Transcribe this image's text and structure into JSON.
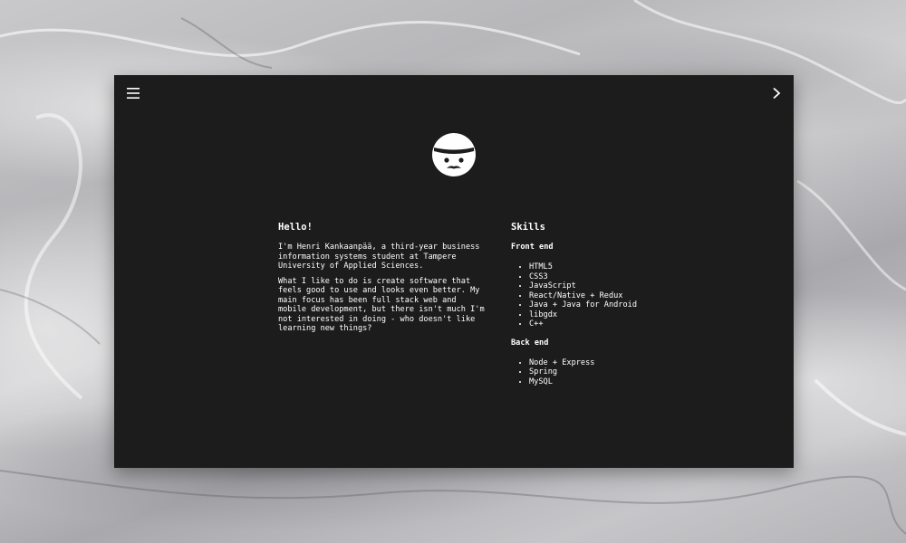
{
  "about": {
    "heading": "Hello!",
    "paragraphs": [
      "I'm Henri Kankaanpää, a third-year business information systems student at Tampere University of Applied Sciences.",
      "What I like to do is create software that feels good to use and looks even better. My main focus has been full stack web and mobile development, but there isn't much I'm not interested in doing - who doesn't like learning new things?"
    ]
  },
  "skills": {
    "heading": "Skills",
    "frontend": {
      "heading": "Front end",
      "items": [
        "HTML5",
        "CSS3",
        "JavaScript",
        "React/Native + Redux",
        "Java + Java for Android",
        "libgdx",
        "C++"
      ]
    },
    "backend": {
      "heading": "Back end",
      "items": [
        "Node + Express",
        "Spring",
        "MySQL"
      ]
    }
  },
  "icons": {
    "menu": "hamburger-menu-icon",
    "next": "chevron-right-icon",
    "avatar": "beanie-face-avatar"
  },
  "colors": {
    "panel": "#1c1c1c",
    "text": "#ffffff"
  }
}
